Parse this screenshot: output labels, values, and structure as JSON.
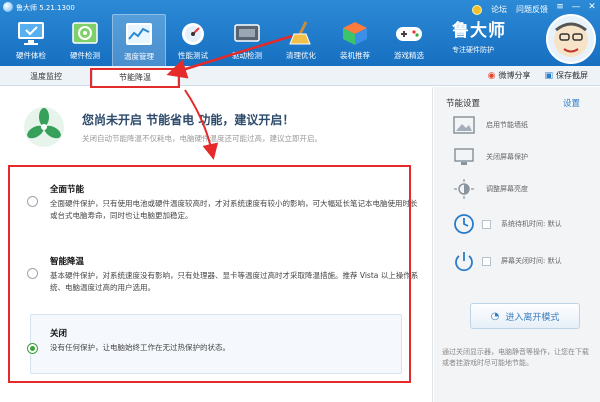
{
  "app": {
    "title": "鲁大师 5.21.1300"
  },
  "top_links": {
    "forum": "论坛",
    "feedback": "问题反馈"
  },
  "window_controls": {
    "menu": "≡",
    "minimize": "—",
    "close": "✕"
  },
  "nav": [
    {
      "label": "硬件体检",
      "icon": "monitor-icon"
    },
    {
      "label": "硬件检测",
      "icon": "chip-icon"
    },
    {
      "label": "温度管理",
      "icon": "temperature-chart-icon"
    },
    {
      "label": "性能测试",
      "icon": "speedometer-icon"
    },
    {
      "label": "驱动检测",
      "icon": "driver-icon"
    },
    {
      "label": "清理优化",
      "icon": "broom-icon"
    },
    {
      "label": "装机推荐",
      "icon": "cube-icon"
    },
    {
      "label": "游戏精选",
      "icon": "gamepad-icon"
    }
  ],
  "brand": {
    "name": "鲁大师",
    "slogan": "专注硬件防护"
  },
  "subtabs": {
    "temp_monitor": "温度监控",
    "energy_saving": "节能降温"
  },
  "subbar_actions": {
    "share": "微博分享",
    "save_screenshot": "保存截屏"
  },
  "banner": {
    "title": "您尚未开启 节能省电 功能，建议开启！",
    "subtitle": "关闭自动节能降温不仅耗电，电脑硬件温度还可能过高，建议立即开启。"
  },
  "options": [
    {
      "title": "全面节能",
      "desc": "全面硬件保护，只有使用电池或硬件温度较高时，才对系统速度有较小的影响，可大幅延长笔记本电脑使用时长或台式电脑寿命，同时也让电脑更加稳定。",
      "checked": false
    },
    {
      "title": "智能降温",
      "desc": "基本硬件保护，对系统速度没有影响，只有处理器、显卡等温度过高时才采取降温措施。推荐 Vista 以上操作系统、电脑温度过高的用户选用。",
      "checked": false
    },
    {
      "title": "关闭",
      "desc": "没有任何保护，让电脑始终工作在无过热保护的状态。",
      "checked": true
    }
  ],
  "side": {
    "title": "节能设置",
    "settings_link": "设置",
    "items": [
      {
        "label": "启用节能墙纸",
        "icon": "wallpaper-icon"
      },
      {
        "label": "关闭屏幕保护",
        "icon": "screen-icon"
      },
      {
        "label": "调整屏幕亮度",
        "icon": "brightness-icon"
      },
      {
        "label": "系统待机时间: 默认",
        "icon": "clock-icon"
      },
      {
        "label": "屏幕关闭时间: 默认",
        "icon": "power-icon"
      }
    ],
    "enter_button": "进入离开模式",
    "note": "通过关闭显示器，电脑静音等操作，让您在下载或者挂游戏时尽可能地节能。"
  },
  "colors": {
    "toolbar": "#1f7dcc",
    "annotation": "#e42a2a",
    "radio_checked": "#3aa63a",
    "link": "#2a7bc9"
  }
}
